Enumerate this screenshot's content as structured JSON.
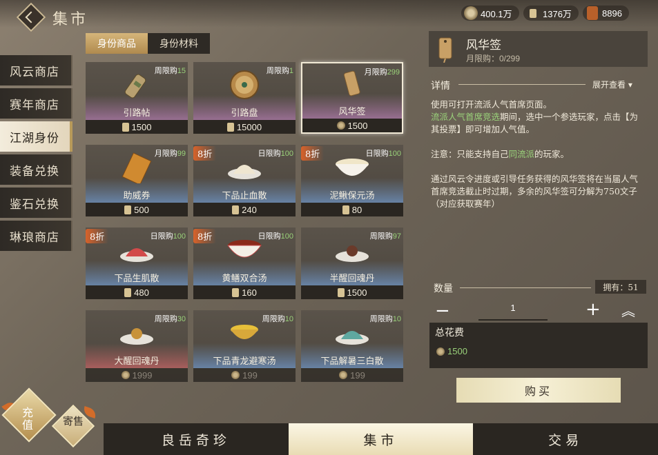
{
  "header": {
    "title": "集市"
  },
  "currencies": [
    {
      "icon": "coin-icon",
      "value": "400.1万"
    },
    {
      "icon": "ticket-icon",
      "value": "1376万"
    },
    {
      "icon": "scroll-icon",
      "value": "8896"
    }
  ],
  "left_nav": {
    "items": [
      {
        "label": "风云商店"
      },
      {
        "label": "赛年商店"
      },
      {
        "label": "江湖身份",
        "active": true
      },
      {
        "label": "装备兑换"
      },
      {
        "label": "鉴石兑换"
      },
      {
        "label": "琳琅商店"
      }
    ]
  },
  "sub_tabs": [
    {
      "label": "身份商品",
      "active": true
    },
    {
      "label": "身份材料"
    }
  ],
  "items": [
    {
      "name": "引路帖",
      "limit_prefix": "周限购",
      "limit_count": "15",
      "price": "1500",
      "currency": "ticket",
      "band": "purple",
      "icon": "scroll-bundle-icon"
    },
    {
      "name": "引路盘",
      "limit_prefix": "周限购",
      "limit_count": "1",
      "price": "15000",
      "currency": "ticket",
      "band": "purple",
      "icon": "compass-icon"
    },
    {
      "name": "风华签",
      "limit_prefix": "月限购",
      "limit_count": "299",
      "price": "1500",
      "currency": "coin",
      "band": "purple",
      "icon": "tag-icon",
      "selected": true
    },
    {
      "name": "助威券",
      "limit_prefix": "月限购",
      "limit_count": "99",
      "price": "500",
      "currency": "ticket",
      "band": "blue",
      "icon": "voucher-icon"
    },
    {
      "name": "下品止血散",
      "limit_prefix": "日限购",
      "limit_count": "100",
      "price": "240",
      "currency": "ticket",
      "band": "blue",
      "icon": "powder-icon",
      "discount": "8折"
    },
    {
      "name": "泥鳅保元汤",
      "limit_prefix": "日限购",
      "limit_count": "100",
      "price": "80",
      "currency": "ticket",
      "band": "blue",
      "icon": "soup-bowl-icon",
      "discount": "8折"
    },
    {
      "name": "下品生肌散",
      "limit_prefix": "日限购",
      "limit_count": "100",
      "price": "480",
      "currency": "ticket",
      "band": "blue",
      "icon": "red-powder-icon",
      "discount": "8折"
    },
    {
      "name": "黄鳝双合汤",
      "limit_prefix": "日限购",
      "limit_count": "100",
      "price": "160",
      "currency": "ticket",
      "band": "blue",
      "icon": "red-soup-icon",
      "discount": "8折"
    },
    {
      "name": "半醒回魂丹",
      "limit_prefix": "周限购",
      "limit_count": "97",
      "price": "1500",
      "currency": "ticket",
      "band": "blue",
      "icon": "pill-icon"
    },
    {
      "name": "大醒回魂丹",
      "limit_prefix": "周限购",
      "limit_count": "30",
      "price": "1999",
      "currency": "coin",
      "band": "red",
      "icon": "gold-pill-icon"
    },
    {
      "name": "下品青龙避寒汤",
      "limit_prefix": "周限购",
      "limit_count": "10",
      "price": "199",
      "currency": "coin",
      "band": "blue",
      "icon": "yellow-soup-icon"
    },
    {
      "name": "下品解暑三白散",
      "limit_prefix": "周限购",
      "limit_count": "10",
      "price": "199",
      "currency": "coin",
      "band": "blue",
      "icon": "teal-powder-icon"
    }
  ],
  "detail": {
    "name": "风华签",
    "monthly_limit": "月限购：0/299",
    "section_label": "详情",
    "expand_label": "展开查看",
    "desc_pre": "使用可打开流派人气首席页面。",
    "desc_hl1": "流派人气首席竞选",
    "desc_mid": "期间，选中一个参选玩家，点击【为其投票】即可增加人气值。",
    "note_pre": "注意：只能支持自己",
    "note_hl": "同流派",
    "note_post": "的玩家。",
    "desc_p3": "通过风云令进度或引导任务获得的风华签将在当届人气首席竞选截止时过期，多余的风华签可分解为750文子（对应获取赛年）",
    "quantity_label": "数量",
    "owned": "拥有：51",
    "quantity": "1",
    "total_label": "总花费",
    "total_value": "1500",
    "buy_label": "购买"
  },
  "bottom_tabs": [
    {
      "label": "良岳奇珍"
    },
    {
      "label": "集市",
      "active": true
    },
    {
      "label": "交易"
    }
  ],
  "corner": {
    "charge_label": "充值",
    "consign_label": "寄售"
  }
}
